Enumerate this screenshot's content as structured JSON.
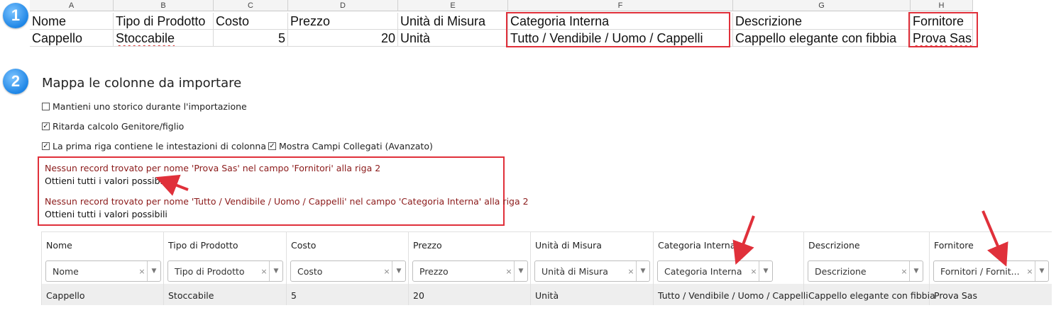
{
  "badges": [
    "1",
    "2"
  ],
  "sheet": {
    "col_letters": [
      "A",
      "B",
      "C",
      "D",
      "E",
      "F",
      "G",
      "H"
    ],
    "header_row": [
      "Nome",
      "Tipo di Prodotto",
      "Costo",
      "Prezzo",
      "Unità di Misura",
      "Categoria Interna",
      "Descrizione",
      "Fornitore"
    ],
    "data_row": [
      "Cappello",
      "Stoccabile",
      "5",
      "20",
      "Unità",
      "Tutto / Vendibile / Uomo / Cappelli",
      "Cappello elegante con fibbia",
      "Prova Sas"
    ]
  },
  "section2": {
    "title": "Mappa le colonne da importare",
    "options": {
      "keep_history": {
        "label": "Mantieni uno storico durante l'importazione",
        "checked": false
      },
      "delay_parent": {
        "label": "Ritarda calcolo Genitore/figlio",
        "checked": true
      },
      "first_row_headers": {
        "label": "La prima riga contiene le intestazioni di colonna",
        "checked": true
      },
      "show_linked": {
        "label": "Mostra Campi Collegati (Avanzato)",
        "checked": true
      }
    },
    "messages": [
      {
        "error": "Nessun record trovato per nome 'Prova Sas' nel campo 'Fornitori' alla riga 2",
        "link": "Ottieni tutti i valori possibili"
      },
      {
        "error": "Nessun record trovato per nome 'Tutto / Vendibile / Uomo / Cappelli' nel campo 'Categoria Interna' alla riga 2",
        "link": "Ottieni tutti i valori possibili"
      }
    ]
  },
  "mapping": {
    "columns": [
      {
        "header": "Nome",
        "field": "Nome",
        "value": "Cappello"
      },
      {
        "header": "Tipo di Prodotto",
        "field": "Tipo di Prodotto",
        "value": "Stoccabile"
      },
      {
        "header": "Costo",
        "field": "Costo",
        "value": "5"
      },
      {
        "header": "Prezzo",
        "field": "Prezzo",
        "value": "20"
      },
      {
        "header": "Unità di Misura",
        "field": "Unità di Misura",
        "value": "Unità"
      },
      {
        "header": "Categoria Interna",
        "field": "Categoria Interna",
        "value": "Tutto / Vendibile / Uomo / Cappelli"
      },
      {
        "header": "Descrizione",
        "field": "Descrizione",
        "value": "Cappello elegante con fibbia"
      },
      {
        "header": "Fornitore",
        "field": "Fornitori / Fornit...",
        "value": "Prova Sas"
      }
    ],
    "clear_glyph": "×",
    "dropdown_glyph": "▼"
  },
  "colors": {
    "highlight": "#e0303a",
    "error_text": "#8b1a1a",
    "badge": "#1f86e6"
  }
}
